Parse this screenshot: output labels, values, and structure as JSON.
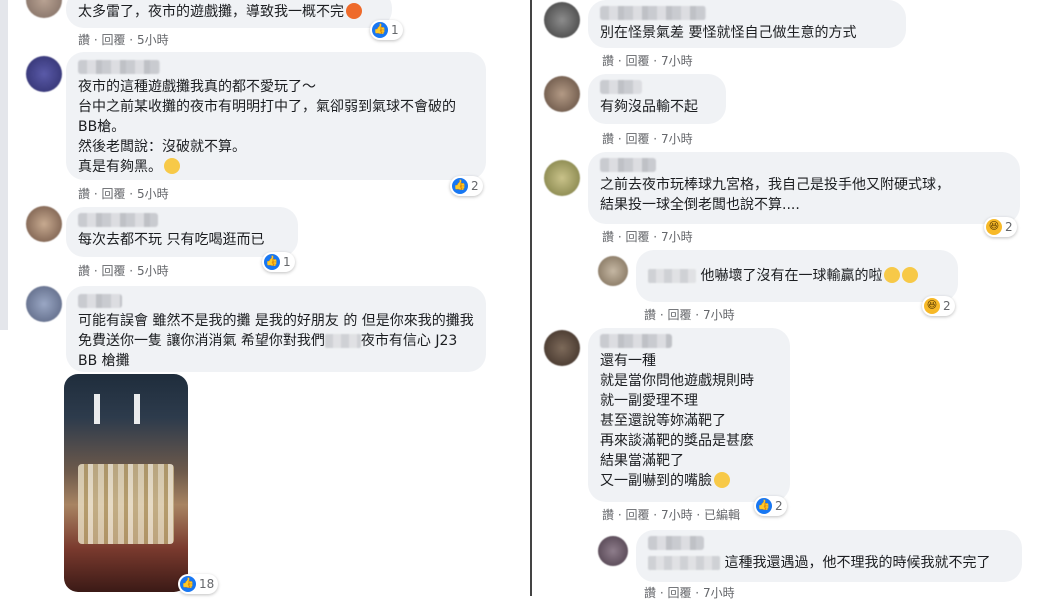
{
  "actions": {
    "like": "讚",
    "reply": "回覆",
    "edited": "已編輯"
  },
  "left": {
    "c0": {
      "text": "太多雷了，夜市的遊戲攤，導致我一概不完",
      "time": "5小時",
      "react_count": "1"
    },
    "c1": {
      "text": "夜市的這種遊戲攤我真的都不愛玩了～\n台中之前某收攤的夜市有明明打中了，氣卻弱到氣球不會破的BB槍。\n然後老闆說：沒破就不算。\n真是有夠黑。",
      "time": "5小時",
      "react_count": "2"
    },
    "c2": {
      "text": "每次去都不玩 只有吃喝逛而已",
      "time": "5小時",
      "react_count": "1"
    },
    "c3": {
      "text_a": "可能有誤會 雖然不是我的攤 是我的好朋友 的 但是你來我的攤我免費送你一隻 讓你消消氣 希望你對我們",
      "text_b": "夜市有信心 J23 BB 槍攤",
      "react_count": "18"
    }
  },
  "right": {
    "c0": {
      "text": "別在怪景氣差 要怪就怪自己做生意的方式",
      "time": "7小時"
    },
    "c1": {
      "text": "有夠沒品輸不起",
      "time": "7小時"
    },
    "c2": {
      "text": "之前去夜市玩棒球九宮格，我自己是投手他又附硬式球，\n結果投一球全倒老闆也說不算....",
      "time": "7小時",
      "react_count": "2"
    },
    "c3": {
      "text": "他嚇壞了沒有在一球輸贏的啦",
      "time": "7小時",
      "react_count": "2"
    },
    "c4": {
      "text": "還有一種\n就是當你問他遊戲規則時\n就一副愛理不理\n甚至還說等妳滿靶了\n再來談滿靶的獎品是甚麼\n結果當滿靶了\n又一副嚇到的嘴臉",
      "time": "7小時",
      "react_count": "2"
    },
    "c5": {
      "text": "這種我還遇過，他不理我的時候我就不完了",
      "time": "7小時"
    }
  },
  "colors": {
    "bubble": "#f0f2f5",
    "meta": "#65676b",
    "like": "#1877f2",
    "haha": "#f7b928"
  }
}
